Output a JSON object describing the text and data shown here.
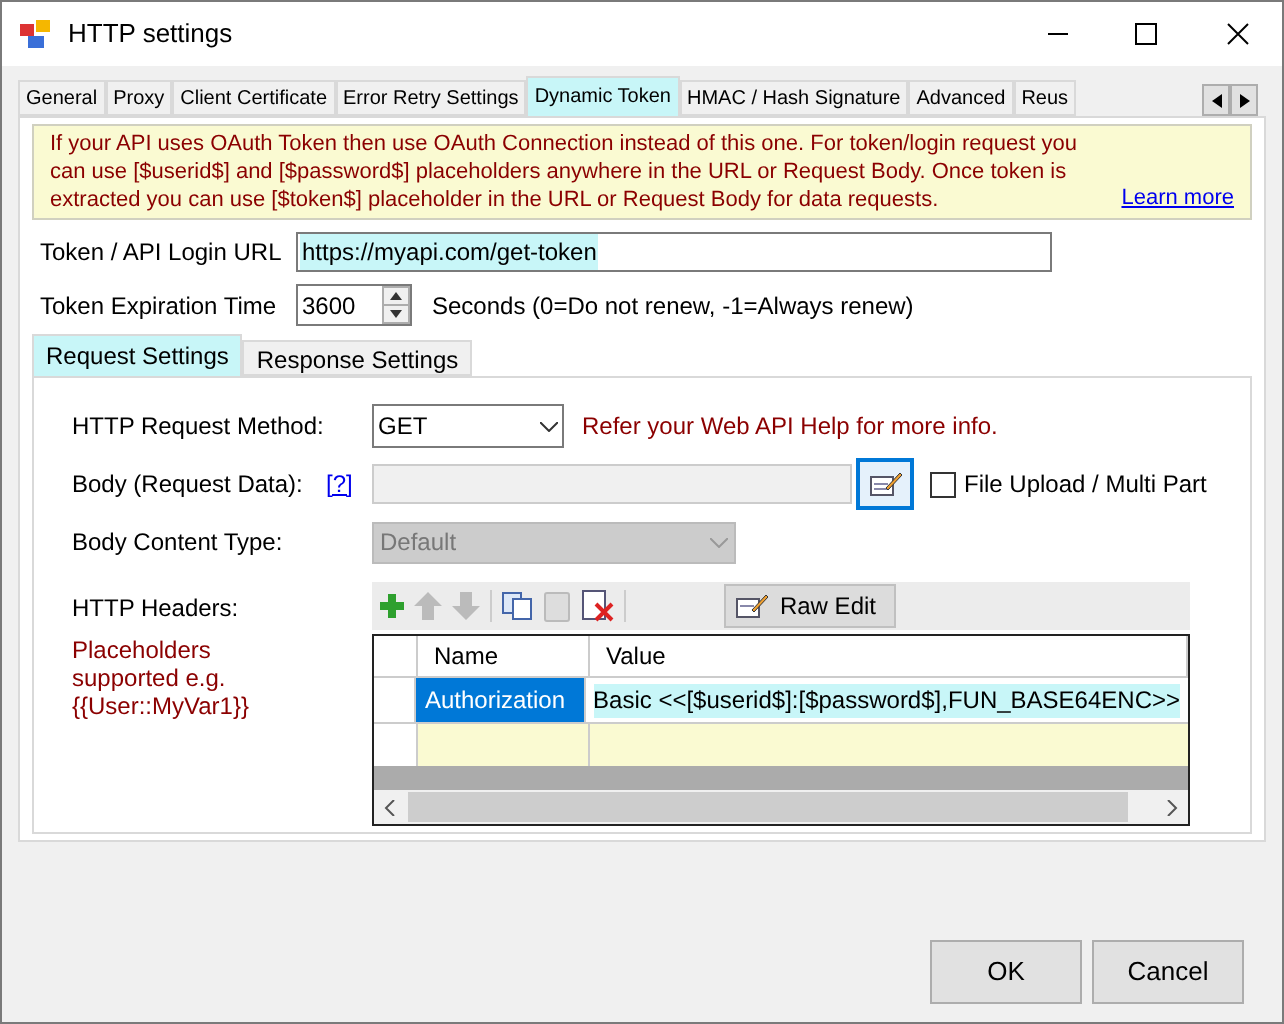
{
  "window": {
    "title": "HTTP settings"
  },
  "tabs": [
    {
      "label": "General",
      "selected": false
    },
    {
      "label": "Proxy",
      "selected": false
    },
    {
      "label": "Client Certificate",
      "selected": false
    },
    {
      "label": "Error Retry Settings",
      "selected": false
    },
    {
      "label": "Dynamic Token",
      "selected": true
    },
    {
      "label": "HMAC / Hash Signature",
      "selected": false
    },
    {
      "label": "Advanced",
      "selected": false
    },
    {
      "label": "Reus",
      "selected": false
    }
  ],
  "info": {
    "text": "If your API uses OAuth Token then use OAuth Connection instead of this one. For token/login request you can use [$userid$] and [$password$] placeholders anywhere in the URL or Request Body. Once token is extracted you can use [$token$] placeholder in the URL or Request Body for data requests.",
    "link": "Learn more"
  },
  "login_url": {
    "label": "Token / API Login URL",
    "value": "https://myapi.com/get-token"
  },
  "expiration": {
    "label": "Token Expiration Time",
    "value": "3600",
    "hint": "Seconds (0=Do not renew, -1=Always renew)"
  },
  "subtabs": [
    {
      "label": "Request Settings",
      "selected": true
    },
    {
      "label": "Response Settings",
      "selected": false
    }
  ],
  "method": {
    "label": "HTTP Request Method:",
    "value": "GET",
    "note": "Refer your Web API Help for more info."
  },
  "body": {
    "label": "Body (Request Data):",
    "help": "[?]",
    "disabled": true,
    "file_upload": {
      "label": "File Upload / Multi Part",
      "checked": false
    }
  },
  "content_type": {
    "label": "Body Content Type:",
    "value": "Default",
    "disabled": true
  },
  "headers": {
    "label": "HTTP Headers:",
    "note": "Placeholders supported e.g. {{User::MyVar1}}",
    "raw_edit": "Raw Edit",
    "columns": [
      "Name",
      "Value"
    ],
    "rows": [
      {
        "name": "Authorization",
        "value": "Basic <<[$userid$]:[$password$],FUN_BASE64ENC>>",
        "selected": true
      }
    ]
  },
  "buttons": [
    {
      "label": "OK"
    },
    {
      "label": "Cancel"
    }
  ]
}
